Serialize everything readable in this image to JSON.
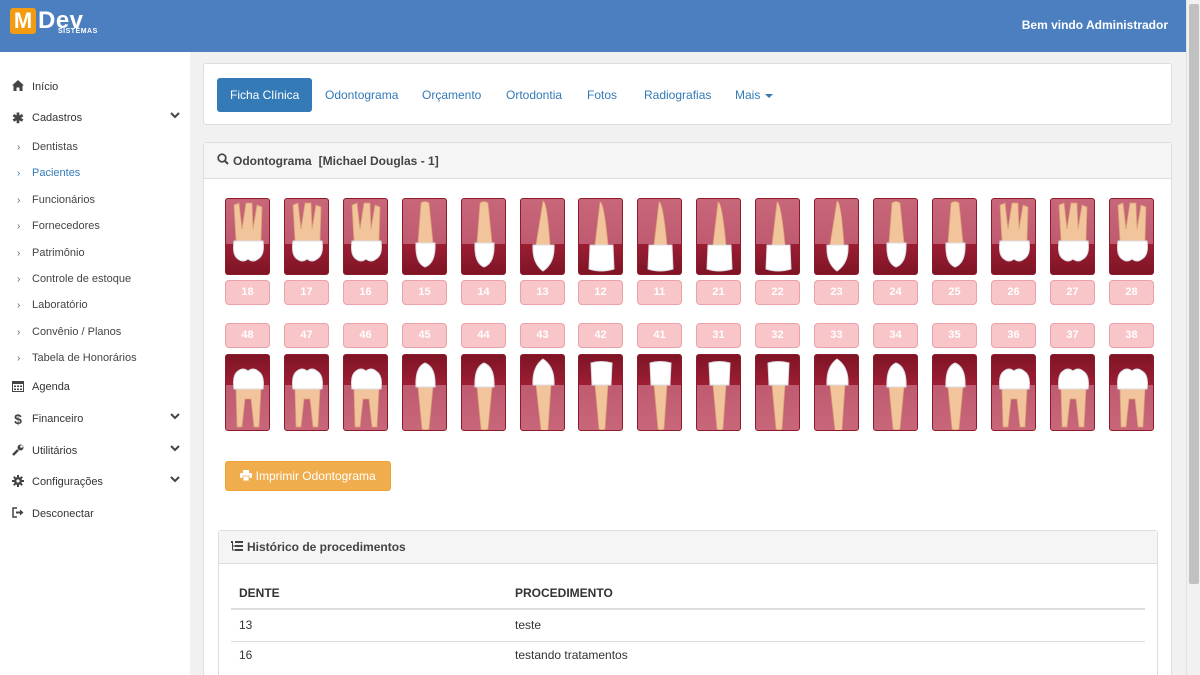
{
  "header": {
    "logo_m": "M",
    "logo_dev": "Dev",
    "logo_sub": "SISTEMAS",
    "welcome": "Bem vindo Administrador"
  },
  "sidebar": {
    "items": [
      {
        "label": "Início",
        "icon": "home-icon"
      },
      {
        "label": "Cadastros",
        "icon": "asterisk-icon"
      },
      {
        "label": "Agenda",
        "icon": "calendar-icon"
      },
      {
        "label": "Financeiro",
        "icon": "dollar-icon"
      },
      {
        "label": "Utilitários",
        "icon": "wrench-icon"
      },
      {
        "label": "Configurações",
        "icon": "gear-icon"
      },
      {
        "label": "Desconectar",
        "icon": "logout-icon"
      }
    ],
    "cadastros_sub": [
      "Dentistas",
      "Pacientes",
      "Funcionários",
      "Fornecedores",
      "Patrimônio",
      "Controle de estoque",
      "Laboratório",
      "Convênio / Planos",
      "Tabela de Honorários"
    ]
  },
  "tabs": [
    {
      "label": "Ficha Clínica",
      "active": true
    },
    {
      "label": "Odontograma"
    },
    {
      "label": "Orçamento"
    },
    {
      "label": "Ortodontia"
    },
    {
      "label": "Fotos"
    },
    {
      "label": "Radiografias"
    },
    {
      "label": "Mais"
    }
  ],
  "odontogram": {
    "title": "Odontograma",
    "patient": "[Michael Douglas - 1]",
    "upper_teeth": [
      "18",
      "17",
      "16",
      "15",
      "14",
      "13",
      "12",
      "11",
      "21",
      "22",
      "23",
      "24",
      "25",
      "26",
      "27",
      "28"
    ],
    "lower_teeth": [
      "48",
      "47",
      "46",
      "45",
      "44",
      "43",
      "42",
      "41",
      "31",
      "32",
      "33",
      "34",
      "35",
      "36",
      "37",
      "38"
    ],
    "print_label": "Imprimir Odontograma"
  },
  "history": {
    "title": "Histórico de procedimentos",
    "columns": [
      "DENTE",
      "PROCEDIMENTO"
    ],
    "rows": [
      {
        "tooth": "13",
        "procedure": "teste"
      },
      {
        "tooth": "16",
        "procedure": "testando tratamentos"
      }
    ]
  },
  "colors": {
    "header": "#4c7fbf",
    "primary": "#337ab7",
    "warning": "#f0ad4e",
    "logo": "#f39c12",
    "gum": "#9c1e33",
    "tooth_label": "#f8c5c9"
  }
}
